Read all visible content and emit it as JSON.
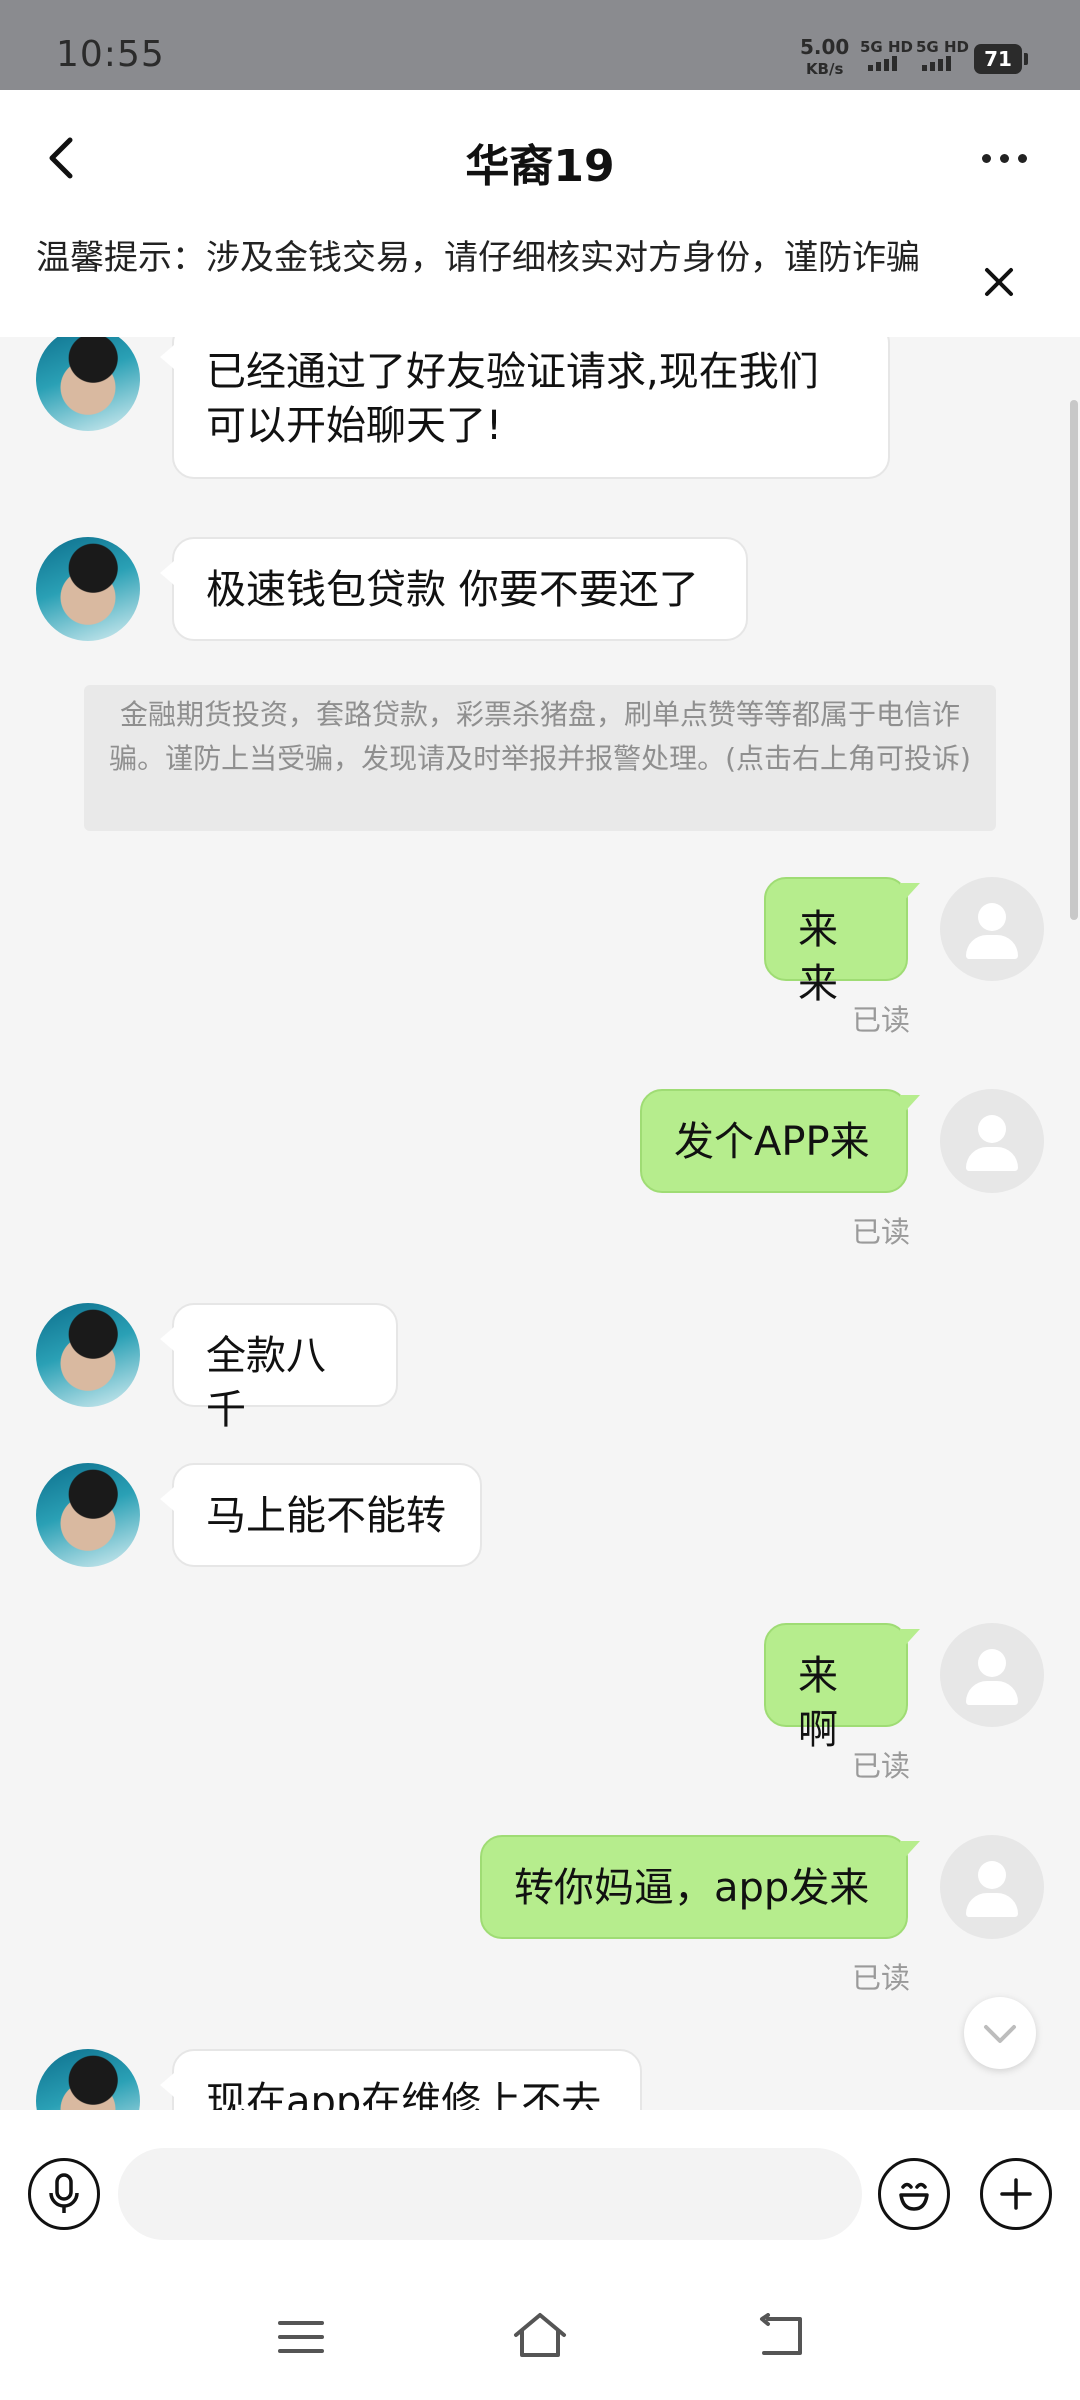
{
  "status_bar": {
    "time": "10:55",
    "speed_value": "5.00",
    "speed_unit": "KB/s",
    "network_1": "5G HD",
    "network_2": "5G HD",
    "battery": "71"
  },
  "header": {
    "title": "华裔19",
    "back_icon": "chevron-left-icon",
    "more_icon": "more-dots-icon"
  },
  "warning": {
    "text": "温馨提示：涉及金钱交易，请仔细核实对方身份，谨防诈骗",
    "close_icon": "close-icon"
  },
  "messages": [
    {
      "from": "other",
      "text_line1": "已经通过了好友验证请求,现在我们",
      "text_line2": "可以开始聊天了!"
    },
    {
      "from": "other",
      "text": "极速钱包贷款 你要不要还了"
    },
    {
      "from": "system",
      "text": "金融期货投资，套路贷款，彩票杀猪盘，刷单点赞等等都属于电信诈骗。谨防上当受骗，发现请及时举报并报警处理。(点击右上角可投诉)"
    },
    {
      "from": "me",
      "text": "来来",
      "status": "已读"
    },
    {
      "from": "me",
      "text": "发个APP来",
      "status": "已读"
    },
    {
      "from": "other",
      "text": "全款八千"
    },
    {
      "from": "other",
      "text": "马上能不能转"
    },
    {
      "from": "me",
      "text": "来啊",
      "status": "已读"
    },
    {
      "from": "me",
      "text": "转你妈逼，app发来",
      "status": "已读"
    },
    {
      "from": "other",
      "text": "现在app在维修上不去"
    }
  ],
  "input_bar": {
    "placeholder": "",
    "voice_icon": "microphone-icon",
    "emoji_icon": "emoji-icon",
    "plus_icon": "plus-icon"
  },
  "nav": {
    "menu_icon": "menu-icon",
    "home_icon": "home-icon",
    "back_icon": "back-icon"
  },
  "colors": {
    "outgoing_bubble": "#b6ed8d",
    "incoming_bubble": "#ffffff",
    "chat_background": "#f5f5f5",
    "status_bar": "#8a8b8f"
  }
}
